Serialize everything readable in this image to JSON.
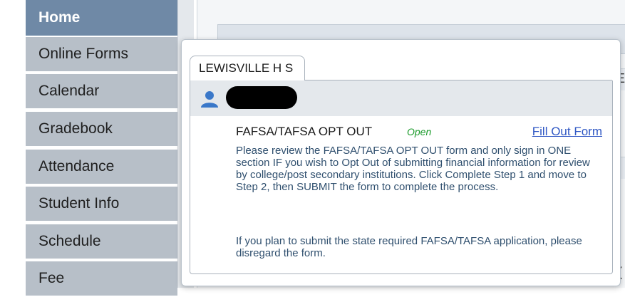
{
  "sidebar": {
    "items": [
      {
        "label": "Home"
      },
      {
        "label": "Online Forms"
      },
      {
        "label": "Calendar"
      },
      {
        "label": "Gradebook"
      },
      {
        "label": "Attendance"
      },
      {
        "label": "Student Info"
      },
      {
        "label": "Schedule"
      },
      {
        "label": "Fee"
      }
    ]
  },
  "popup": {
    "tab_label": "LEWISVILLE H S",
    "student_icon": "person-icon",
    "form": {
      "title": "FAFSA/TAFSA OPT OUT",
      "status": "Open",
      "link_label": "Fill Out Form",
      "description": "Please review the FAFSA/TAFSA OPT OUT form and only sign in ONE section IF you wish to Opt Out of submitting financial information for review by college/post secondary institutions. Click Complete Step 1 and move to Step 2, then SUBMIT the form to complete the process.",
      "note": "If you plan to submit the state required FAFSA/TAFSA application, please disregard the form."
    }
  },
  "colors": {
    "nav_active": "#6f89a6",
    "nav_inactive": "#b7bfc8",
    "status_open": "#1a9a2a",
    "link": "#2f57c4",
    "description_text": "#2f4f6e"
  }
}
